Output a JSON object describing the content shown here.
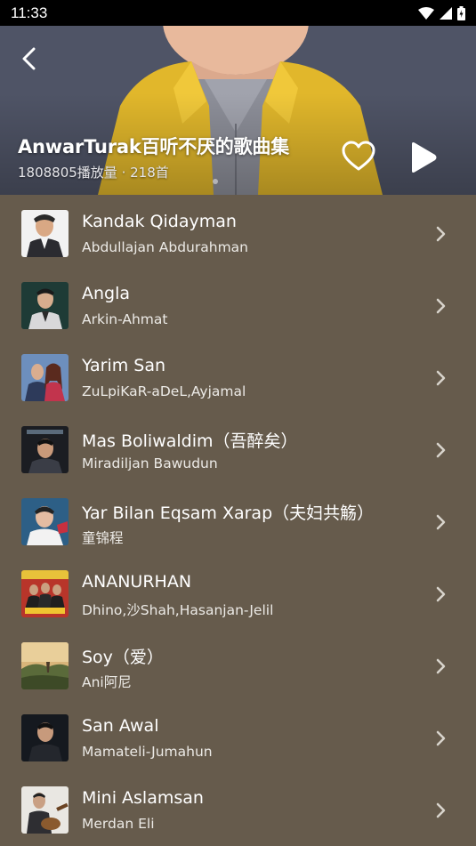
{
  "status_bar": {
    "time": "11:33"
  },
  "header": {
    "title": "AnwarTurak百听不厌的歌曲集",
    "meta": "1808805播放量 · 218首"
  },
  "songs": [
    {
      "title": "Kandak Qidayman",
      "artist": "Abdullajan Abdurahman"
    },
    {
      "title": "Angla",
      "artist": "Arkin-Ahmat"
    },
    {
      "title": "Yarim San",
      "artist": "ZuLpiKaR-aDeL,Ayjamal"
    },
    {
      "title": "Mas Boliwaldim（吾醉矣）",
      "artist": "Miradiljan Bawudun"
    },
    {
      "title": "Yar Bilan Eqsam Xarap（夫妇共觞）",
      "artist": "童锦程"
    },
    {
      "title": "ANANURHAN",
      "artist": "Dhino,沙Shah,Hasanjan-Jelil"
    },
    {
      "title": "Soy（爱）",
      "artist": "Ani阿尼"
    },
    {
      "title": "San Awal",
      "artist": "Mamateli-Jumahun"
    },
    {
      "title": "Mini Aslamsan",
      "artist": "Merdan Eli"
    }
  ],
  "icons": {
    "back": "back-arrow-icon",
    "like": "heart-icon",
    "play": "play-icon",
    "row": "chevron-right-icon"
  },
  "colors": {
    "list_background": "#665b4c",
    "status_bar": "#000000"
  }
}
